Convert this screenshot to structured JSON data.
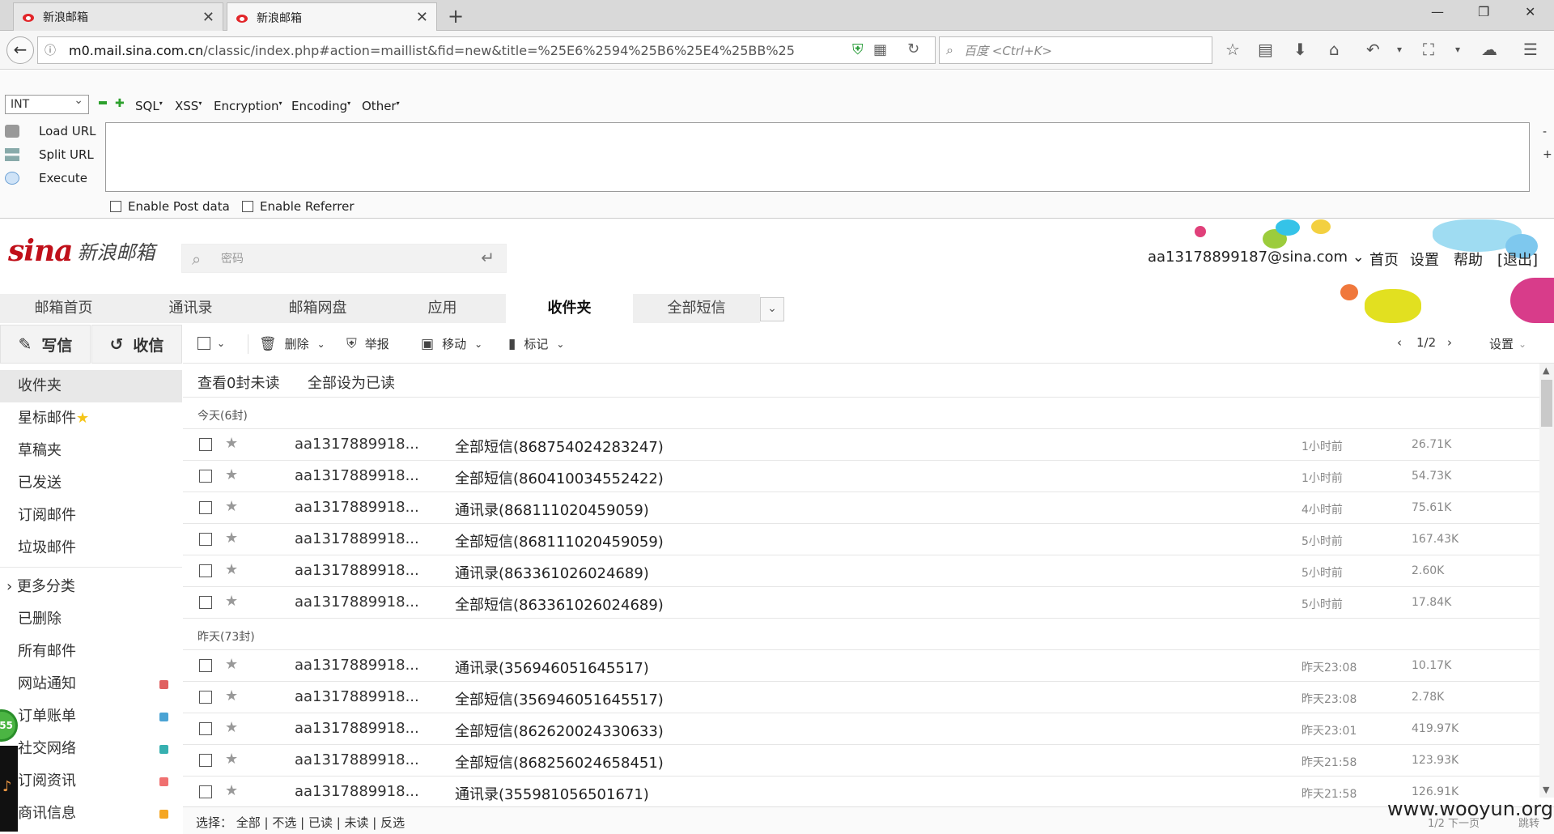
{
  "browser": {
    "tabs": [
      {
        "title": "新浪邮箱",
        "active": false
      },
      {
        "title": "新浪邮箱",
        "active": true
      }
    ],
    "url_host": "m0.mail.sina.com.cn",
    "url_path": "/classic/index.php#action=maillist&fid=new&title=%25E6%2594%25B6%25E4%25BB%25",
    "search_placeholder": "百度 <Ctrl+K>"
  },
  "hackbar": {
    "type_select": "INT",
    "menus": [
      "SQL",
      "XSS",
      "Encryption",
      "Encoding",
      "Other"
    ],
    "actions": [
      "Load URL",
      "Split URL",
      "Execute"
    ],
    "checks": [
      "Enable Post data",
      "Enable Referrer"
    ],
    "side_minus": "-",
    "side_plus": "+"
  },
  "mail": {
    "logo_text": "sina",
    "logo_cn": "新浪邮箱",
    "search_placeholder": "密码",
    "account": "aa13178899187@sina.com",
    "top_links": [
      "首页",
      "设置",
      "帮助",
      "[退出]"
    ],
    "nav_tabs": [
      "邮箱首页",
      "通讯录",
      "邮箱网盘",
      "应用",
      "收件夹",
      "全部短信"
    ],
    "compose_label": "写信",
    "receive_label": "收信",
    "sidebar": [
      {
        "label": "收件夹"
      },
      {
        "label": "星标邮件"
      },
      {
        "label": "草稿夹"
      },
      {
        "label": "已发送"
      },
      {
        "label": "订阅邮件"
      },
      {
        "label": "垃圾邮件"
      }
    ],
    "sidebar_more": "更多分类",
    "sidebar2": [
      {
        "label": "已删除",
        "color": ""
      },
      {
        "label": "所有邮件",
        "color": ""
      },
      {
        "label": "网站通知",
        "color": "#e06060"
      },
      {
        "label": "订单账单",
        "color": "#4aa3d4"
      },
      {
        "label": "社交网络",
        "color": "#36b0b0"
      },
      {
        "label": "订阅资讯",
        "color": "#f07070"
      },
      {
        "label": "商讯信息",
        "color": "#f5a623"
      }
    ],
    "toolbar": {
      "delete": "删除",
      "report": "举报",
      "move": "移动",
      "mark": "标记",
      "page": "1/2",
      "settings": "设置"
    },
    "subbar": [
      "查看0封未读",
      "全部设为已读"
    ],
    "groups": [
      {
        "label": "今天(6封)",
        "rows": [
          {
            "from": "aa1317889918...",
            "subject": "全部短信(868754024283247)",
            "time": "1小时前",
            "size": "26.71K"
          },
          {
            "from": "aa1317889918...",
            "subject": "全部短信(860410034552422)",
            "time": "1小时前",
            "size": "54.73K"
          },
          {
            "from": "aa1317889918...",
            "subject": "通讯录(868111020459059)",
            "time": "4小时前",
            "size": "75.61K"
          },
          {
            "from": "aa1317889918...",
            "subject": "全部短信(868111020459059)",
            "time": "5小时前",
            "size": "167.43K"
          },
          {
            "from": "aa1317889918...",
            "subject": "通讯录(863361026024689)",
            "time": "5小时前",
            "size": "2.60K"
          },
          {
            "from": "aa1317889918...",
            "subject": "全部短信(863361026024689)",
            "time": "5小时前",
            "size": "17.84K"
          }
        ]
      },
      {
        "label": "昨天(73封)",
        "rows": [
          {
            "from": "aa1317889918...",
            "subject": "通讯录(356946051645517)",
            "time": "昨天23:08",
            "size": "10.17K"
          },
          {
            "from": "aa1317889918...",
            "subject": "全部短信(356946051645517)",
            "time": "昨天23:08",
            "size": "2.78K"
          },
          {
            "from": "aa1317889918...",
            "subject": "全部短信(862620024330633)",
            "time": "昨天23:01",
            "size": "419.97K"
          },
          {
            "from": "aa1317889918...",
            "subject": "全部短信(868256024658451)",
            "time": "昨天21:58",
            "size": "123.93K"
          },
          {
            "from": "aa1317889918...",
            "subject": "通讯录(355981056501671)",
            "time": "昨天21:58",
            "size": "126.91K"
          }
        ]
      }
    ],
    "footer_select": "选择： 全部 | 不选 | 已读 | 未读 | 反选",
    "footer_page": "1/2  下一页",
    "footer_jump": "跳转",
    "float_badge": "55"
  },
  "watermark": "www.wooyun.org"
}
